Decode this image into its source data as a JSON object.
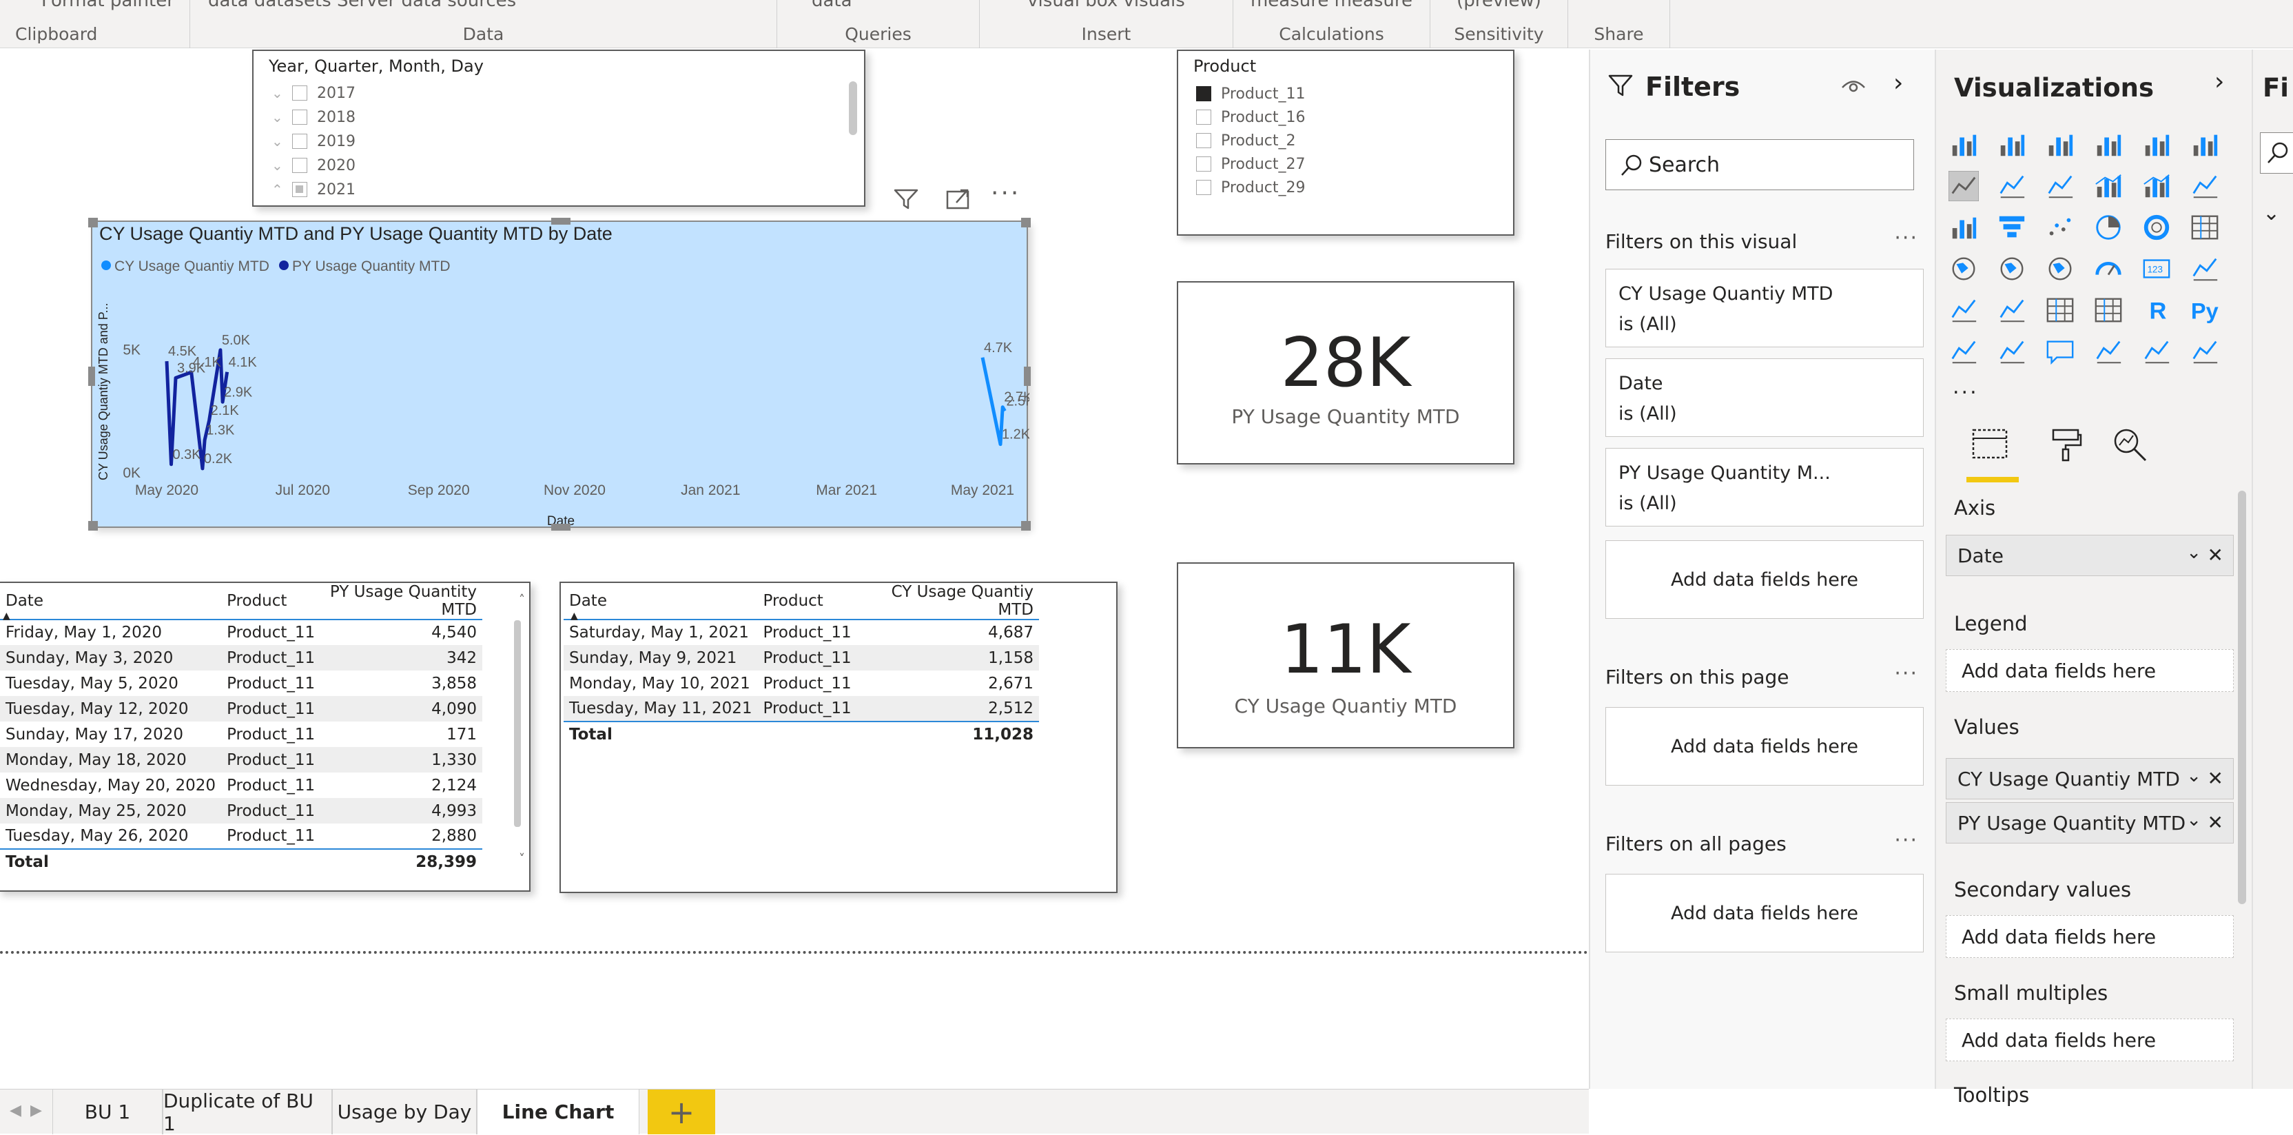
{
  "ribbon": {
    "groups": [
      {
        "label": "Clipboard",
        "top": "Format painter"
      },
      {
        "label": "Data",
        "top": "data       datasets  Server   data              sources"
      },
      {
        "label": "Queries",
        "top": "data"
      },
      {
        "label": "Insert",
        "top": "visual     box   visuals"
      },
      {
        "label": "Calculations",
        "top": "measure measure"
      },
      {
        "label": "Sensitivity",
        "top": "(preview)"
      },
      {
        "label": "Share",
        "top": ""
      }
    ]
  },
  "slicer_date": {
    "title": "Year, Quarter, Month, Day",
    "items": [
      "2017",
      "2018",
      "2019",
      "2020",
      "2021"
    ]
  },
  "slicer_product": {
    "title": "Product",
    "items": [
      "Product_11",
      "Product_16",
      "Product_2",
      "Product_27",
      "Product_29"
    ],
    "selected_index": 0
  },
  "card_py": {
    "value": "28K",
    "label": "PY Usage Quantity MTD"
  },
  "card_cy": {
    "value": "11K",
    "label": "CY Usage Quantiy MTD"
  },
  "chart_data": {
    "type": "line",
    "title": "CY Usage Quantiy MTD and PY Usage Quantity MTD by Date",
    "xlabel": "Date",
    "ylabel": "CY Usage Quantiy MTD and P...",
    "x_ticks": [
      "May 2020",
      "Jul 2020",
      "Sep 2020",
      "Nov 2020",
      "Jan 2021",
      "Mar 2021",
      "May 2021"
    ],
    "y_ticks": [
      "0K",
      "5K"
    ],
    "ylim": [
      0,
      6000
    ],
    "legend": "top-left",
    "series": [
      {
        "name": "CY Usage Quantiy MTD",
        "color": "#118dff",
        "x": [
          "2021-05-01",
          "2021-05-09",
          "2021-05-10",
          "2021-05-11"
        ],
        "values": [
          4687,
          1158,
          2671,
          2512
        ],
        "labels": [
          "4.7K",
          "1.2K",
          "2.7K",
          "2.5K"
        ]
      },
      {
        "name": "PY Usage Quantity MTD",
        "color": "#12239e",
        "x": [
          "2020-05-01",
          "2020-05-03",
          "2020-05-05",
          "2020-05-12",
          "2020-05-17",
          "2020-05-18",
          "2020-05-20",
          "2020-05-25",
          "2020-05-26",
          "2020-05-28"
        ],
        "values": [
          4540,
          342,
          3858,
          4090,
          171,
          1330,
          2124,
          4993,
          2880,
          4100
        ],
        "labels": [
          "4.5K",
          "0.3K",
          "3.9K",
          "4.1K",
          "0.2K",
          "1.3K",
          "2.1K",
          "5.0K",
          "2.9K",
          "4.1K"
        ]
      }
    ]
  },
  "table_py": {
    "headers": [
      "Date",
      "Product",
      "PY Usage Quantity MTD"
    ],
    "rows": [
      [
        "Friday, May 1, 2020",
        "Product_11",
        "4,540"
      ],
      [
        "Sunday, May 3, 2020",
        "Product_11",
        "342"
      ],
      [
        "Tuesday, May 5, 2020",
        "Product_11",
        "3,858"
      ],
      [
        "Tuesday, May 12, 2020",
        "Product_11",
        "4,090"
      ],
      [
        "Sunday, May 17, 2020",
        "Product_11",
        "171"
      ],
      [
        "Monday, May 18, 2020",
        "Product_11",
        "1,330"
      ],
      [
        "Wednesday, May 20, 2020",
        "Product_11",
        "2,124"
      ],
      [
        "Monday, May 25, 2020",
        "Product_11",
        "4,993"
      ],
      [
        "Tuesday, May 26, 2020",
        "Product_11",
        "2,880"
      ]
    ],
    "total_label": "Total",
    "total_value": "28,399"
  },
  "table_cy": {
    "headers": [
      "Date",
      "Product",
      "CY Usage Quantiy MTD"
    ],
    "rows": [
      [
        "Saturday, May 1, 2021",
        "Product_11",
        "4,687"
      ],
      [
        "Sunday, May 9, 2021",
        "Product_11",
        "1,158"
      ],
      [
        "Monday, May 10, 2021",
        "Product_11",
        "2,671"
      ],
      [
        "Tuesday, May 11, 2021",
        "Product_11",
        "2,512"
      ]
    ],
    "total_label": "Total",
    "total_value": "11,028"
  },
  "filters": {
    "title": "Filters",
    "search_placeholder": "Search",
    "on_visual": "Filters on this visual",
    "visual_filters": [
      {
        "name": "CY Usage Quantiy MTD",
        "state": "is (All)"
      },
      {
        "name": "Date",
        "state": "is (All)"
      },
      {
        "name": "PY Usage Quantity M...",
        "state": "is (All)"
      }
    ],
    "add_fields": "Add data fields here",
    "on_page": "Filters on this page",
    "on_all": "Filters on all pages"
  },
  "viz": {
    "title": "Visualizations",
    "more": "...",
    "wells": {
      "axis": "Axis",
      "axis_field": "Date",
      "legend": "Legend",
      "values": "Values",
      "value_fields": [
        "CY Usage Quantiy MTD",
        "PY Usage Quantity MTD"
      ],
      "secondary": "Secondary values",
      "small": "Small multiples",
      "tooltips": "Tooltips",
      "add": "Add data fields here"
    }
  },
  "fields_pane": {
    "title": "Fi"
  },
  "tabs": [
    "BU 1",
    "Duplicate of BU 1",
    "Usage by Day",
    "Line Chart"
  ],
  "active_tab": 3,
  "colors": {
    "accent": "#f2c811",
    "cy": "#118dff",
    "py": "#12239e",
    "selection": "#c2e2ff"
  }
}
